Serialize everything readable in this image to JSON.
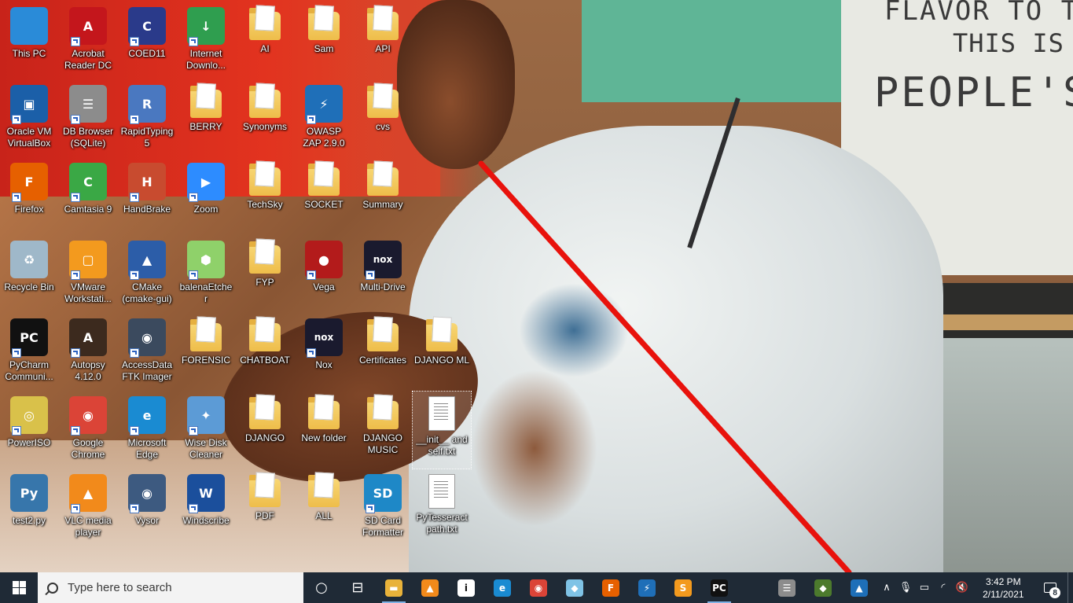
{
  "desktop": {
    "icons": [
      {
        "label": "This PC",
        "icon": "pc-monitor-icon",
        "kind": "app",
        "shortcut": false,
        "color": "#2a8bd8"
      },
      {
        "label": "Acrobat Reader DC",
        "icon": "pdf-icon",
        "kind": "app",
        "shortcut": true,
        "color": "#c4161c",
        "glyph": "A"
      },
      {
        "label": "COED11",
        "icon": "coed-icon",
        "kind": "app",
        "shortcut": true,
        "color": "#2a3a8a",
        "glyph": "C"
      },
      {
        "label": "Internet Downlo...",
        "icon": "download-globe-icon",
        "kind": "app",
        "shortcut": true,
        "color": "#2f9e4f",
        "glyph": "↓"
      },
      {
        "label": "AI",
        "icon": "folder-icon",
        "kind": "folder",
        "shortcut": false
      },
      {
        "label": "Sam",
        "icon": "folder-icon",
        "kind": "folder",
        "shortcut": false
      },
      {
        "label": "API",
        "icon": "folder-icon",
        "kind": "folder",
        "shortcut": false
      },
      {
        "label": "Oracle VM VirtualBox",
        "icon": "virtualbox-icon",
        "kind": "app",
        "shortcut": true,
        "color": "#1b5fa8",
        "glyph": "▣"
      },
      {
        "label": "DB Browser (SQLite)",
        "icon": "database-icon",
        "kind": "app",
        "shortcut": true,
        "color": "#8c8c8c",
        "glyph": "☰"
      },
      {
        "label": "RapidTyping 5",
        "icon": "rapidtyping-icon",
        "kind": "app",
        "shortcut": true,
        "color": "#4a78c0",
        "glyph": "R"
      },
      {
        "label": "BERRY",
        "icon": "folder-icon",
        "kind": "folder",
        "shortcut": false
      },
      {
        "label": "Synonyms",
        "icon": "folder-icon",
        "kind": "folder",
        "shortcut": false
      },
      {
        "label": "OWASP ZAP 2.9.0",
        "icon": "zap-icon",
        "kind": "app",
        "shortcut": true,
        "color": "#1f6fb8",
        "glyph": "⚡"
      },
      {
        "label": "cvs",
        "icon": "folder-icon",
        "kind": "folder",
        "shortcut": false
      },
      {
        "label": "Firefox",
        "icon": "firefox-icon",
        "kind": "app",
        "shortcut": true,
        "color": "#e66000",
        "glyph": "F"
      },
      {
        "label": "Camtasia 9",
        "icon": "camtasia-icon",
        "kind": "app",
        "shortcut": true,
        "color": "#3aa845",
        "glyph": "C"
      },
      {
        "label": "HandBrake",
        "icon": "handbrake-icon",
        "kind": "app",
        "shortcut": true,
        "color": "#c84b2f",
        "glyph": "H"
      },
      {
        "label": "Zoom",
        "icon": "zoom-icon",
        "kind": "app",
        "shortcut": true,
        "color": "#2d8cff",
        "glyph": "▶"
      },
      {
        "label": "TechSky",
        "icon": "folder-icon",
        "kind": "folder",
        "shortcut": false
      },
      {
        "label": "SOCKET",
        "icon": "folder-icon",
        "kind": "folder",
        "shortcut": false
      },
      {
        "label": "Summary",
        "icon": "folder-icon",
        "kind": "folder",
        "shortcut": false
      },
      {
        "label": "Recycle Bin",
        "icon": "recycle-bin-icon",
        "kind": "app",
        "shortcut": false,
        "color": "#9fb8c9",
        "glyph": "♻"
      },
      {
        "label": "VMware Workstati...",
        "icon": "vmware-icon",
        "kind": "app",
        "shortcut": true,
        "color": "#f39a1e",
        "glyph": "▢"
      },
      {
        "label": "CMake (cmake-gui)",
        "icon": "cmake-icon",
        "kind": "app",
        "shortcut": true,
        "color": "#2c5da8",
        "glyph": "▲"
      },
      {
        "label": "balenaEtcher",
        "icon": "etcher-icon",
        "kind": "app",
        "shortcut": true,
        "color": "#8fd16a",
        "glyph": "⬢"
      },
      {
        "label": "FYP",
        "icon": "folder-icon",
        "kind": "folder",
        "shortcut": false
      },
      {
        "label": "Vega",
        "icon": "vega-icon",
        "kind": "app",
        "shortcut": true,
        "color": "#b31b1b",
        "glyph": "●"
      },
      {
        "label": "Multi-Drive",
        "icon": "nox-icon",
        "kind": "app",
        "shortcut": true,
        "color": "#1a1a2e",
        "glyph": "nox"
      },
      {
        "label": "PyCharm Communi...",
        "icon": "pycharm-icon",
        "kind": "app",
        "shortcut": true,
        "color": "#111111",
        "glyph": "PC"
      },
      {
        "label": "Autopsy 4.12.0",
        "icon": "autopsy-icon",
        "kind": "app",
        "shortcut": true,
        "color": "#3c2a1e",
        "glyph": "A"
      },
      {
        "label": "AccessData FTK Imager",
        "icon": "ftk-icon",
        "kind": "app",
        "shortcut": true,
        "color": "#3b4a5e",
        "glyph": "◉"
      },
      {
        "label": "FORENSIC",
        "icon": "folder-icon",
        "kind": "folder",
        "shortcut": false
      },
      {
        "label": "CHATBOAT",
        "icon": "folder-icon",
        "kind": "folder",
        "shortcut": false
      },
      {
        "label": "Nox",
        "icon": "nox-icon",
        "kind": "app",
        "shortcut": true,
        "color": "#1a1a2e",
        "glyph": "nox"
      },
      {
        "label": "Certificates",
        "icon": "folder-icon",
        "kind": "folder",
        "shortcut": false
      },
      {
        "label": "DJANGO ML",
        "icon": "folder-icon",
        "kind": "folder",
        "shortcut": false
      },
      {
        "label": "PowerISO",
        "icon": "poweriso-icon",
        "kind": "app",
        "shortcut": true,
        "color": "#d9c14a",
        "glyph": "◎"
      },
      {
        "label": "Google Chrome",
        "icon": "chrome-icon",
        "kind": "app",
        "shortcut": true,
        "color": "#db4437",
        "glyph": "◉"
      },
      {
        "label": "Microsoft Edge",
        "icon": "edge-icon",
        "kind": "app",
        "shortcut": true,
        "color": "#1a8bd2",
        "glyph": "e"
      },
      {
        "label": "Wise Disk Cleaner",
        "icon": "disk-cleaner-icon",
        "kind": "app",
        "shortcut": true,
        "color": "#5c9bd6",
        "glyph": "✦"
      },
      {
        "label": "DJANGO",
        "icon": "folder-icon",
        "kind": "folder",
        "shortcut": false
      },
      {
        "label": "New folder",
        "icon": "folder-icon",
        "kind": "folder",
        "shortcut": false
      },
      {
        "label": "DJANGO MUSIC",
        "icon": "folder-icon",
        "kind": "folder",
        "shortcut": false
      },
      {
        "label": "__init__ and self.txt",
        "icon": "text-file-icon",
        "kind": "doc",
        "shortcut": false,
        "selected": true
      },
      {
        "label": "test2.py",
        "icon": "python-file-icon",
        "kind": "app",
        "shortcut": false,
        "color": "#3776ab",
        "glyph": "Py"
      },
      {
        "label": "VLC media player",
        "icon": "vlc-icon",
        "kind": "app",
        "shortcut": true,
        "color": "#f28a1b",
        "glyph": "▲"
      },
      {
        "label": "Vysor",
        "icon": "vysor-icon",
        "kind": "app",
        "shortcut": true,
        "color": "#3d5a80",
        "glyph": "◉"
      },
      {
        "label": "Windscribe",
        "icon": "windscribe-icon",
        "kind": "app",
        "shortcut": true,
        "color": "#1b4f9c",
        "glyph": "W"
      },
      {
        "label": "PDF",
        "icon": "folder-icon",
        "kind": "folder",
        "shortcut": false
      },
      {
        "label": "ALL",
        "icon": "folder-icon",
        "kind": "folder",
        "shortcut": false
      },
      {
        "label": "SD Card Formatter",
        "icon": "sd-card-icon",
        "kind": "app",
        "shortcut": true,
        "color": "#1e88c7",
        "glyph": "SD"
      },
      {
        "label": "PyTesseract path.txt",
        "icon": "text-file-icon",
        "kind": "doc",
        "shortcut": false
      }
    ],
    "wallpaper_sign": [
      "FLAVOR TO THE",
      "THIS IS THE",
      "PEOPLE'S F"
    ],
    "annotation_color": "#e8120c"
  },
  "taskbar": {
    "search_placeholder": "Type here to search",
    "pinned": [
      {
        "name": "cortana-icon",
        "glyph": "○",
        "bg": "transparent",
        "active": false
      },
      {
        "name": "task-view-icon",
        "glyph": "⊟",
        "bg": "transparent",
        "active": false
      },
      {
        "name": "file-explorer-icon",
        "glyph": "▬",
        "bg": "#e8b23a",
        "active": true
      },
      {
        "name": "vlc-icon",
        "glyph": "▲",
        "bg": "#f28a1b",
        "active": false
      },
      {
        "name": "info-icon",
        "glyph": "i",
        "bg": "#ffffff",
        "active": false
      },
      {
        "name": "edge-icon",
        "glyph": "e",
        "bg": "#1a8bd2",
        "active": false
      },
      {
        "name": "chrome-icon",
        "glyph": "◉",
        "bg": "#db4437",
        "active": false
      },
      {
        "name": "snip-tool-icon",
        "glyph": "◆",
        "bg": "#7fc3e6",
        "active": false
      },
      {
        "name": "firefox-icon",
        "glyph": "F",
        "bg": "#e66000",
        "active": false
      },
      {
        "name": "zap-icon",
        "glyph": "⚡",
        "bg": "#1f6fb8",
        "active": false
      },
      {
        "name": "sublime-icon",
        "glyph": "S",
        "bg": "#f39a1e",
        "active": false
      },
      {
        "name": "pycharm-icon",
        "glyph": "PC",
        "bg": "#111111",
        "active": true
      },
      {
        "name": "spacer",
        "glyph": "",
        "bg": "transparent",
        "active": false
      },
      {
        "name": "db-browser-icon",
        "glyph": "☰",
        "bg": "#8c8c8c",
        "active": false
      },
      {
        "name": "git-icon",
        "glyph": "◆",
        "bg": "#4c7a2d",
        "active": false
      },
      {
        "name": "photos-icon",
        "glyph": "▲",
        "bg": "#1e6fb8",
        "active": false
      }
    ],
    "tray": [
      {
        "name": "show-hidden-icons-icon",
        "glyph": "∧"
      },
      {
        "name": "microphone-icon",
        "glyph": "🎙"
      },
      {
        "name": "battery-icon",
        "glyph": "▭"
      },
      {
        "name": "wifi-icon",
        "glyph": "◜"
      },
      {
        "name": "volume-muted-icon",
        "glyph": "🔇"
      }
    ],
    "time": "3:42 PM",
    "date": "2/11/2021",
    "notification_count": "8"
  }
}
